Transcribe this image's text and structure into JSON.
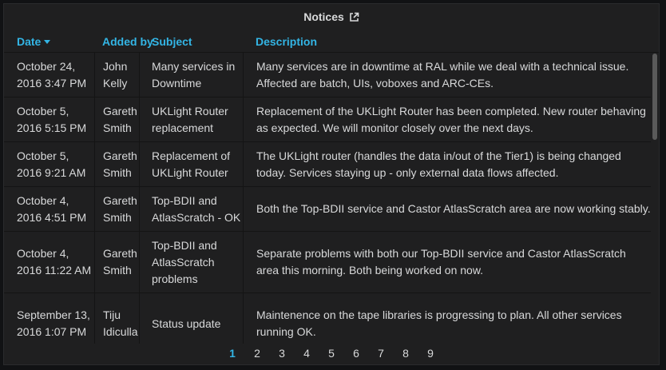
{
  "panel": {
    "title": "Notices",
    "external_link_icon": "external-link-icon"
  },
  "columns": {
    "date": "Date",
    "added_by": "Added by",
    "subject": "Subject",
    "description": "Description"
  },
  "rows": [
    {
      "date": "October 24, 2016 3:47 PM",
      "added_by": "John Kelly",
      "subject": "Many services in Downtime",
      "description": "Many services are in downtime at RAL while we deal with a technical issue. Affected are batch, UIs, voboxes and ARC-CEs."
    },
    {
      "date": "October 5, 2016 5:15 PM",
      "added_by": "Gareth Smith",
      "subject": "UKLight Router replacement",
      "description": "Replacement of the UKLight Router has been completed. New router behaving as expected. We will monitor closely over the next days."
    },
    {
      "date": "October 5, 2016 9:21 AM",
      "added_by": "Gareth Smith",
      "subject": "Replacement of UKLight Router",
      "description": "The UKLight router (handles the data in/out of the Tier1) is being changed today. Services staying up - only external data flows affected."
    },
    {
      "date": "October 4, 2016 4:51 PM",
      "added_by": "Gareth Smith",
      "subject": "Top-BDII and AtlasScratch - OK",
      "description": "Both the Top-BDII service and Castor AtlasScratch area are now working stably."
    },
    {
      "date": "October 4, 2016 11:22 AM",
      "added_by": "Gareth Smith",
      "subject": "Top-BDII and AtlasScratch problems",
      "description": "Separate problems with both our Top-BDII service and Castor AtlasScratch area this morning. Both being worked on now."
    },
    {
      "date": "September 13, 2016 1:07 PM",
      "added_by": "Tiju Idiculla",
      "subject": "Status update",
      "description": "Maintenence on the tape libraries is progressing to plan. All other services running OK."
    }
  ],
  "pagination": {
    "pages": [
      "1",
      "2",
      "3",
      "4",
      "5",
      "6",
      "7",
      "8",
      "9"
    ],
    "current": "1"
  },
  "colors": {
    "accent": "#33b5e5",
    "panel_bg": "#1f1f20",
    "text": "#d8d9da"
  }
}
